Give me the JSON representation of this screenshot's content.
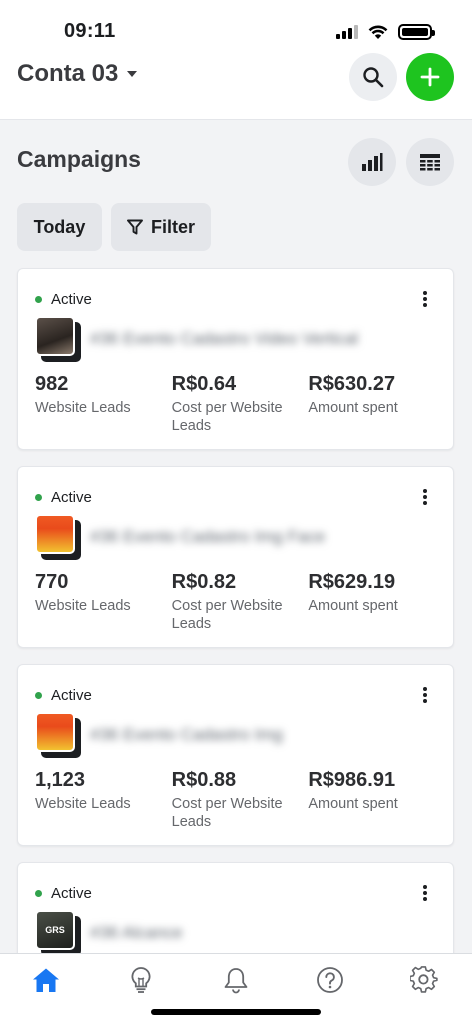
{
  "status_bar": {
    "time": "09:11"
  },
  "header": {
    "account_name": "Conta 03",
    "icons": {
      "dropdown": "caret-down-icon",
      "search": "search-icon",
      "add": "plus-icon"
    },
    "colors": {
      "add_button": "#1ec41f"
    }
  },
  "section": {
    "title": "Campaigns",
    "icons": {
      "chart": "bar-chart-icon",
      "table": "table-icon"
    }
  },
  "filters": {
    "date_label": "Today",
    "filter_label": "Filter",
    "filter_icon": "funnel-icon"
  },
  "campaigns": [
    {
      "status": "Active",
      "name": "#36 Evento Cadastro Video Vertical",
      "metrics": [
        {
          "value": "982",
          "label": "Website Leads"
        },
        {
          "value": "R$0.64",
          "label": "Cost per Website Leads"
        },
        {
          "value": "R$630.27",
          "label": "Amount spent"
        }
      ]
    },
    {
      "status": "Active",
      "name": "#36 Evento Cadastro Img Face",
      "metrics": [
        {
          "value": "770",
          "label": "Website Leads"
        },
        {
          "value": "R$0.82",
          "label": "Cost per Website Leads"
        },
        {
          "value": "R$629.19",
          "label": "Amount spent"
        }
      ]
    },
    {
      "status": "Active",
      "name": "#36 Evento Cadastro Img",
      "metrics": [
        {
          "value": "1,123",
          "label": "Website Leads"
        },
        {
          "value": "R$0.88",
          "label": "Cost per Website Leads"
        },
        {
          "value": "R$986.91",
          "label": "Amount spent"
        }
      ]
    },
    {
      "status": "Active",
      "name": "#36 Alcance",
      "thumb_text": "GRS",
      "metrics": []
    }
  ],
  "status_color": "#31a24c",
  "bottom_nav": {
    "items": [
      "home-icon",
      "lightbulb-icon",
      "bell-icon",
      "help-icon",
      "gear-icon"
    ],
    "active_color": "#1877f2"
  }
}
